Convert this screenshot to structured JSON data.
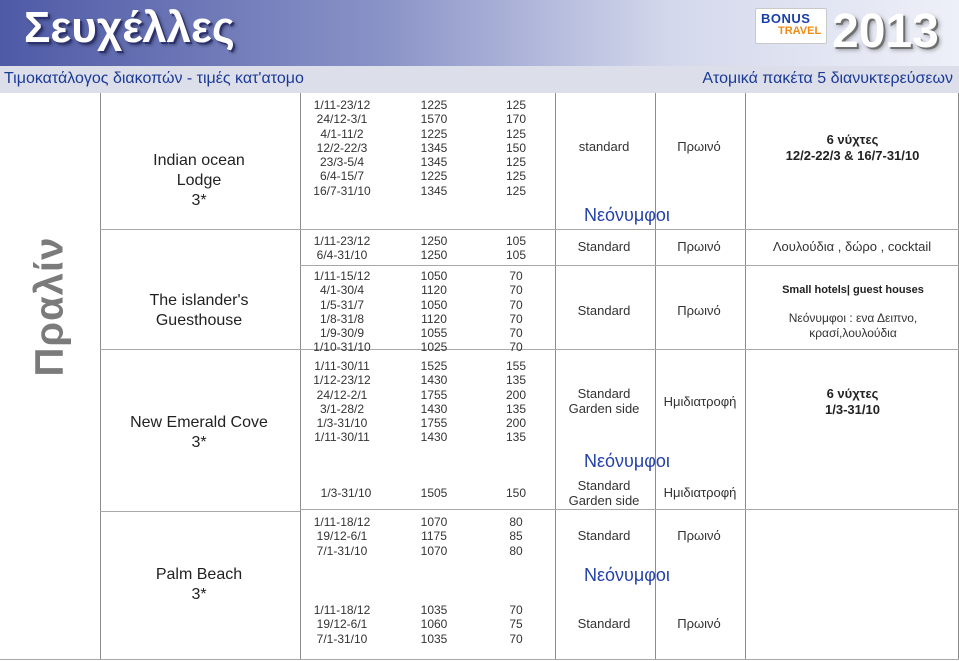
{
  "header": {
    "title": "Σευχέλλες",
    "logo_line1": "BONUS",
    "logo_line2": "TRAVEL",
    "year": "2013",
    "subtitle_left": "Τιμοκατάλογος διακοπών  - τιμές κατ'ατομο",
    "subtitle_right": "Ατομικά πακέτα 5 διανυκτερεύσεων"
  },
  "side_label": "Πραλίν",
  "hotels": [
    {
      "name": "Indian ocean\nLodge\n3*"
    },
    {
      "name": "The islander's\nGuesthouse"
    },
    {
      "name": "New Emerald Cove\n3*"
    },
    {
      "name": "Palm Beach\n3*"
    }
  ],
  "blocks": [
    {
      "dates": "1/11-23/12\n24/12-3/1\n4/1-11/2\n12/2-22/3\n23/3-5/4\n6/4-15/7\n16/7-31/10",
      "price1": "1225\n1570\n1225\n1345\n1345\n1225\n1345",
      "price2": "125\n170\n125\n150\n125\n125\n125",
      "room": "standard",
      "board": "Πρωινό",
      "note": "6 νύχτες\n12/2-22/3 & 16/7-31/10"
    },
    {
      "dates": "1/11-23/12\n6/4-31/10",
      "price1": "1250\n1250",
      "price2": "105\n105",
      "room": "Standard",
      "board": "Πρωινό",
      "note": "Λουλούδια , δώρο , cocktail"
    },
    {
      "dates": "1/11-15/12\n4/1-30/4\n1/5-31/7\n1/8-31/8\n1/9-30/9\n1/10-31/10",
      "price1": "1050\n1120\n1050\n1120\n1055\n1025",
      "price2": "70\n70\n70\n70\n70\n70",
      "room": "Standard",
      "board": "Πρωινό",
      "note_bold": "Small hotels| guest houses",
      "note": "Νεόνυμφοι : ενα Δειπνο,\nκρασί,λουλούδια"
    },
    {
      "dates": "1/11-30/11\n1/12-23/12\n24/12-2/1\n3/1-28/2\n1/3-31/10\n1/11-30/11",
      "price1": "1525\n1430\n1755\n1430\n1755\n1430",
      "price2": "155\n135\n200\n135\n200\n135",
      "room": "Standard\nGarden side",
      "board": "Ημιδιατροφή",
      "note": "6 νύχτες\n1/3-31/10"
    },
    {
      "dates": "1/3-31/10",
      "price1": "1505",
      "price2": "150",
      "room": "Standard\nGarden side",
      "board": "Ημιδιατροφή"
    },
    {
      "dates": "1/11-18/12\n19/12-6/1\n7/1-31/10",
      "price1": "1070\n1175\n1070",
      "price2": "80\n85\n80",
      "room": "Standard",
      "board": "Πρωινό"
    },
    {
      "dates": "1/11-18/12\n19/12-6/1\n7/1-31/10",
      "price1": "1035\n1060\n1035",
      "price2": "70\n75\n70",
      "room": "Standard",
      "board": "Πρωινό"
    }
  ],
  "newlywed_label": "Νεόνυμφοι"
}
